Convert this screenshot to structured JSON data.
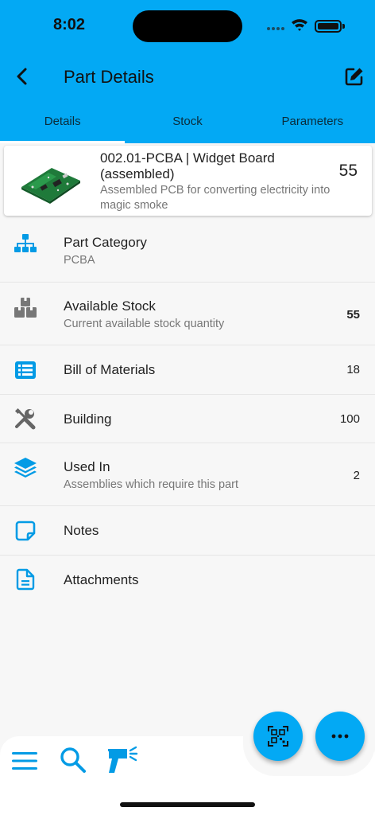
{
  "status_bar": {
    "time": "8:02"
  },
  "appbar": {
    "title": "Part Details"
  },
  "tabs": [
    {
      "label": "Details",
      "active": true
    },
    {
      "label": "Stock",
      "active": false
    },
    {
      "label": "Parameters",
      "active": false
    }
  ],
  "part": {
    "name": "002.01-PCBA | Widget Board (assembled)",
    "description": "Assembled PCB for converting electricity into magic smoke",
    "count": "55",
    "image": "pcb-thumbnail"
  },
  "rows": [
    {
      "icon": "sitemap-icon",
      "title": "Part Category",
      "subtitle": "PCBA",
      "value": ""
    },
    {
      "icon": "boxes-icon",
      "title": "Available Stock",
      "subtitle": "Current available stock quantity",
      "value": "55"
    },
    {
      "icon": "list-icon",
      "title": "Bill of Materials",
      "subtitle": "",
      "value": "18"
    },
    {
      "icon": "tools-icon",
      "title": "Building",
      "subtitle": "",
      "value": "100"
    },
    {
      "icon": "layers-icon",
      "title": "Used In",
      "subtitle": "Assemblies which require this part",
      "value": "2"
    },
    {
      "icon": "note-icon",
      "title": "Notes",
      "subtitle": "",
      "value": ""
    },
    {
      "icon": "file-icon",
      "title": "Attachments",
      "subtitle": "",
      "value": ""
    }
  ],
  "colors": {
    "primary": "#03a9f4",
    "icon": "#039be5",
    "background": "#f7f7f7"
  },
  "icons": {
    "back": "back-arrow-icon",
    "edit": "edit-icon",
    "scan_fab": "qr-scan-icon",
    "more_fab": "more-horizontal-icon",
    "nav": [
      "menu-icon",
      "search-icon",
      "barcode-scanner-icon"
    ]
  }
}
